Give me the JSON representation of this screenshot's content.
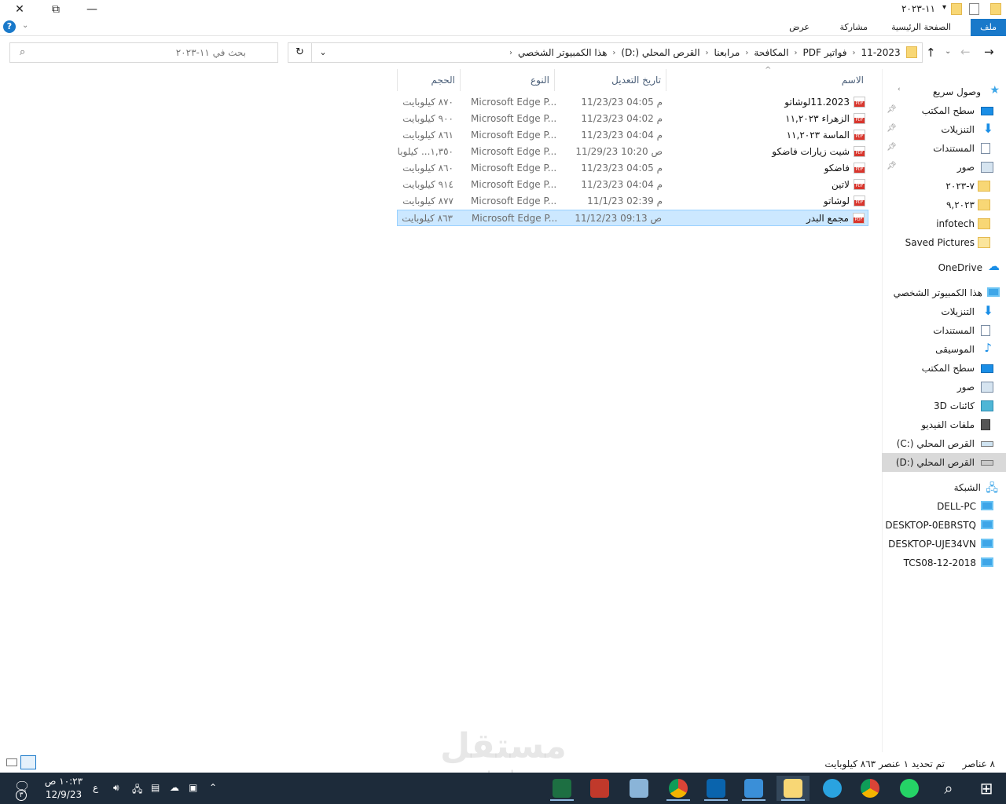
{
  "window": {
    "title": "١١-٢٠٢٣"
  },
  "ribbon": {
    "file": "ملف",
    "home": "الصفحة الرئيسية",
    "share": "مشاركة",
    "view": "عرض"
  },
  "breadcrumb": [
    "هذا الكمبيوتر الشخصي",
    "القرص المحلي (:D)",
    "مرابعنا",
    "المكافحة",
    "فواتير PDF",
    "11-2023"
  ],
  "search": {
    "placeholder": "بحث في ١١-٢٠٢٣"
  },
  "columns": {
    "name": "الاسم",
    "date": "تاريخ التعديل",
    "type": "النوع",
    "size": "الحجم"
  },
  "files": [
    {
      "name": "11.2023لوشاتو",
      "date": "م 04:05 11/23/23",
      "type": "Microsoft Edge P...",
      "size": "٨٧٠ كيلوبايت"
    },
    {
      "name": "الزهراء ١١,٢٠٢٣",
      "date": "م 04:02 11/23/23",
      "type": "Microsoft Edge P...",
      "size": "٩٠٠ كيلوبايت"
    },
    {
      "name": "الماسة ١١,٢٠٢٣",
      "date": "م 04:04 11/23/23",
      "type": "Microsoft Edge P...",
      "size": "٨٦١ كيلوبايت"
    },
    {
      "name": "شيت زيارات فاضكو",
      "date": "ص 10:20 11/29/23",
      "type": "Microsoft Edge P...",
      "size": "١,٣٥٠... كيلوبا"
    },
    {
      "name": "فاضكو",
      "date": "م 04:05 11/23/23",
      "type": "Microsoft Edge P...",
      "size": "٨٦٠ كيلوبايت"
    },
    {
      "name": "لاتين",
      "date": "م 04:04 11/23/23",
      "type": "Microsoft Edge P...",
      "size": "٩١٤ كيلوبايت"
    },
    {
      "name": "لوشاتو",
      "date": "م 02:39 11/1/23",
      "type": "Microsoft Edge P...",
      "size": "٨٧٧ كيلوبايت"
    },
    {
      "name": "مجمع البدر",
      "date": "ص 09:13 11/12/23",
      "type": "Microsoft Edge P...",
      "size": "٨٦٣ كيلوبايت"
    }
  ],
  "sidebar": {
    "quick_access": "وصول سريع",
    "quick": [
      "سطح المكتب",
      "التنزيلات",
      "المستندات",
      "صور",
      "٧-٢٠٢٣",
      "٩,٢٠٢٣",
      "infotech",
      "Saved Pictures"
    ],
    "onedrive": "OneDrive",
    "this_pc": "هذا الكمبيوتر الشخصي",
    "pc_items": [
      "التنزيلات",
      "المستندات",
      "الموسيقى",
      "سطح المكتب",
      "صور",
      "كائنات 3D",
      "ملفات الفيديو",
      "القرص المحلي (:C)",
      "القرص المحلي (:D)"
    ],
    "network": "الشبكة",
    "net_items": [
      "DELL-PC",
      "DESKTOP-0EBRSTQ",
      "DESKTOP-UJE34VN",
      "TCS08-12-2018"
    ]
  },
  "status": {
    "count": "٨ عناصر",
    "selected": "تم تحديد ١ عنصر  ٨٦٣ كيلوبايت"
  },
  "taskbar": {
    "time": "١٠:٢٣ ص",
    "date": "12/9/23",
    "lang": "ع",
    "notif": "٣"
  },
  "watermark": {
    "ar": "مستقل",
    "en": "mostaql.com"
  },
  "colors": {
    "accent": "#1979ca",
    "selection": "#cce8ff",
    "taskbar": "#1d2b3a"
  }
}
